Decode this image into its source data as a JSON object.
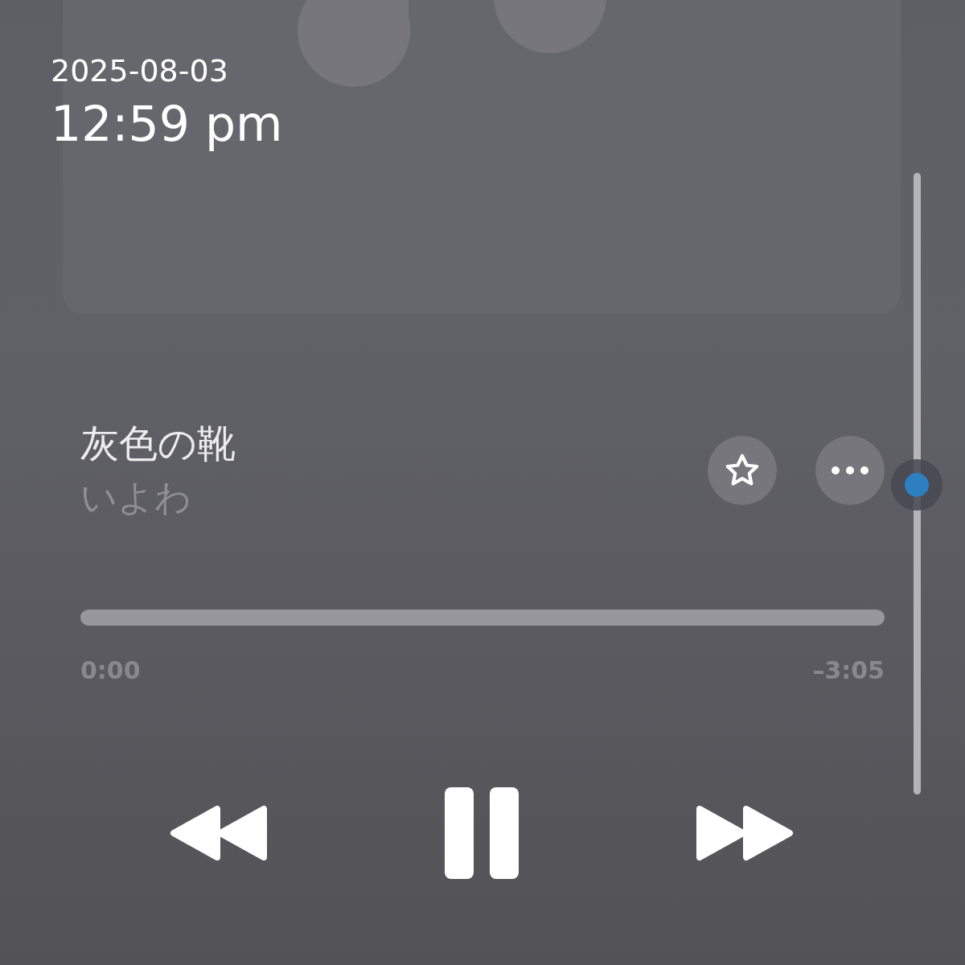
{
  "overlay": {
    "date": "2025-08-03",
    "time": "12:59 pm"
  },
  "track": {
    "title": "灰色の靴",
    "artist": "いよわ"
  },
  "progress": {
    "level": 0,
    "elapsed": "0:00",
    "remaining": "–3:05"
  },
  "playback": {
    "playing": true
  }
}
